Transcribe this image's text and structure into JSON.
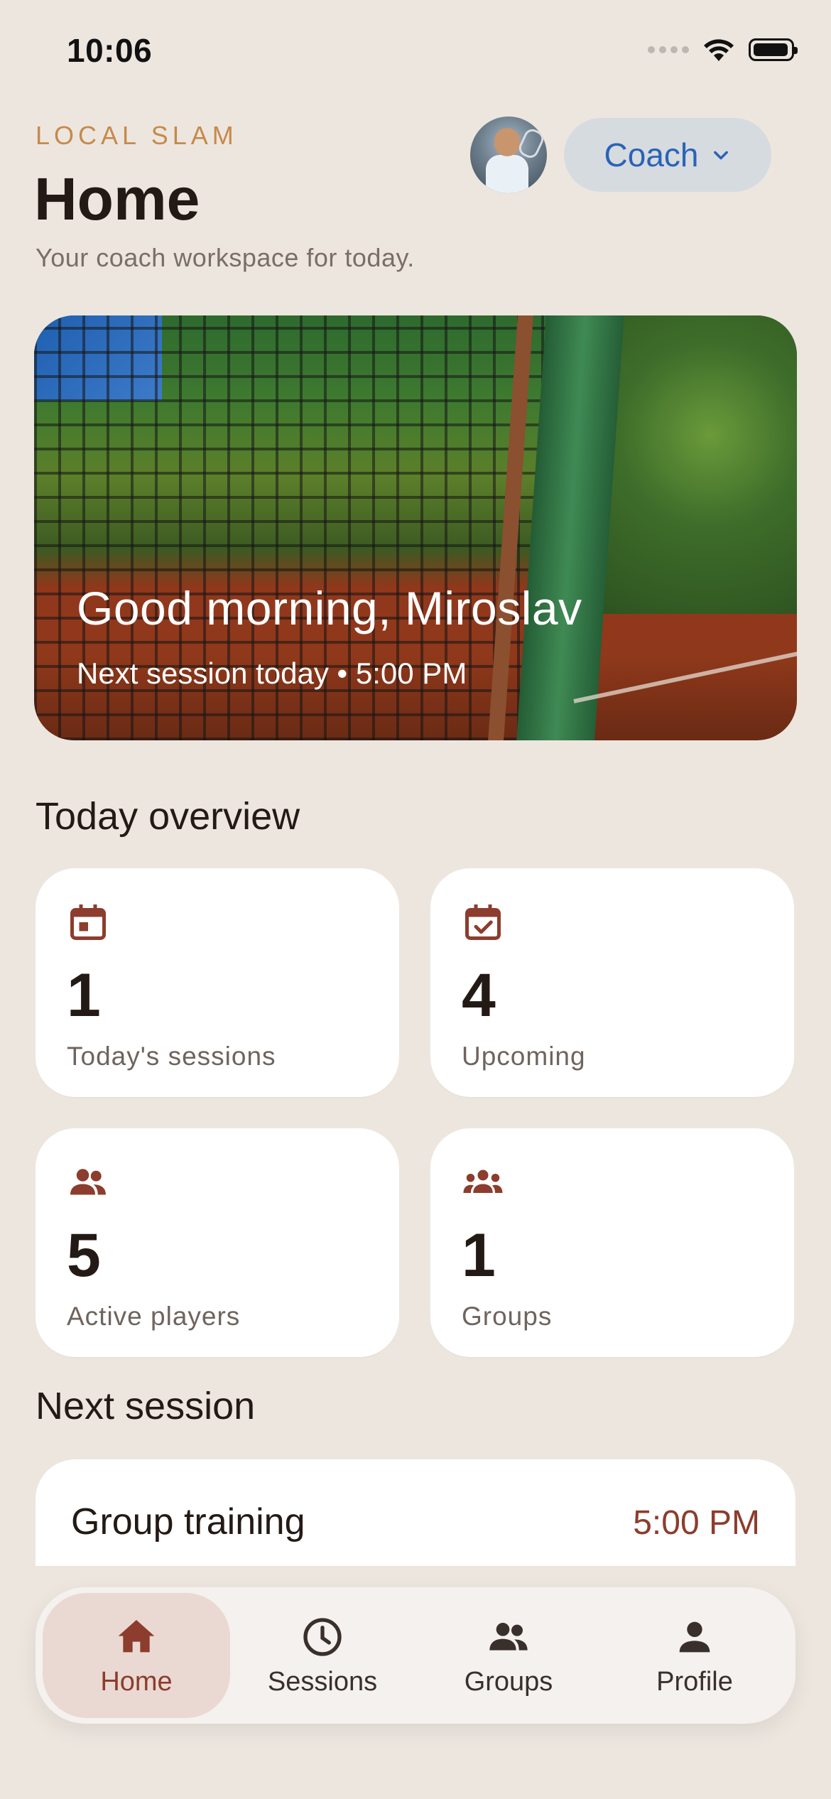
{
  "status": {
    "time": "10:06"
  },
  "header": {
    "brand": "LOCAL SLAM",
    "title": "Home",
    "subtitle": "Your coach workspace for today.",
    "role_button": "Coach"
  },
  "hero": {
    "greeting": "Good morning, Miroslav",
    "next_session": "Next session today • 5:00 PM"
  },
  "overview": {
    "title": "Today overview",
    "cards": [
      {
        "icon": "calendar-icon",
        "value": "1",
        "label": "Today's sessions"
      },
      {
        "icon": "calendar-check-icon",
        "value": "4",
        "label": "Upcoming"
      },
      {
        "icon": "players-icon",
        "value": "5",
        "label": "Active players"
      },
      {
        "icon": "groups-icon",
        "value": "1",
        "label": "Groups"
      }
    ]
  },
  "next_session": {
    "title": "Next session",
    "name": "Group training",
    "time": "5:00 PM"
  },
  "nav": {
    "items": [
      {
        "label": "Home",
        "icon": "home-icon",
        "active": true
      },
      {
        "label": "Sessions",
        "icon": "clock-icon",
        "active": false
      },
      {
        "label": "Groups",
        "icon": "groups-icon",
        "active": false
      },
      {
        "label": "Profile",
        "icon": "profile-icon",
        "active": false
      }
    ]
  },
  "colors": {
    "background": "#EDE6DF",
    "accent": "#8C3D2D",
    "brand": "#C58A4B",
    "role_text": "#2A63B6"
  }
}
